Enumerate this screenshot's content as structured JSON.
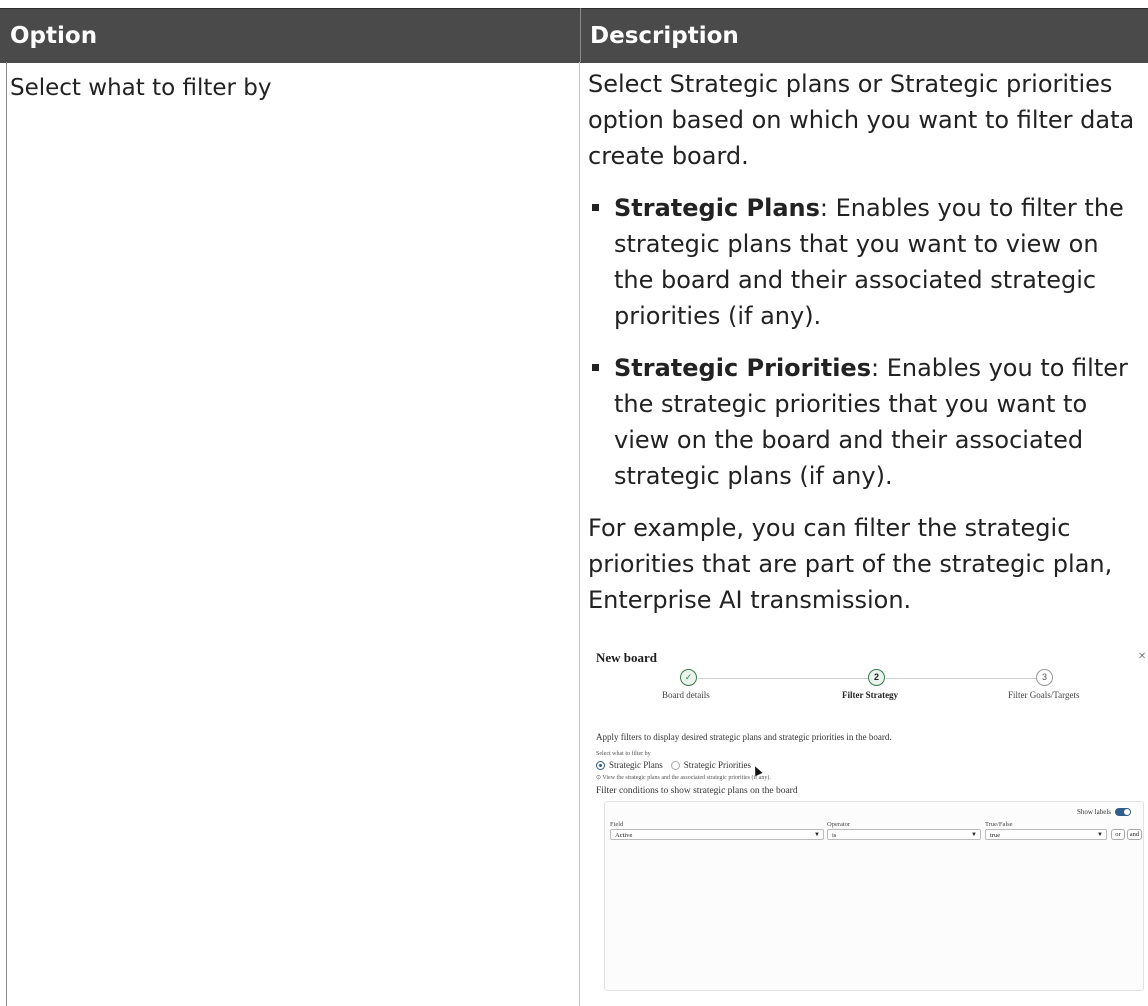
{
  "table": {
    "headers": [
      "Option",
      "Description"
    ],
    "option": "Select what to filter by",
    "description": {
      "intro": "Select Strategic plans or Strategic priorities option based on which you want to filter data create board.",
      "bullets": [
        {
          "term": "Strategic Plans",
          "text": ": Enables you to filter the strategic plans that you want to view on the board and their associated strategic priorities (if any)."
        },
        {
          "term": "Strategic Priorities",
          "text": ": Enables you to filter the strategic priorities that you want to view on the board and their associated strategic plans (if any)."
        }
      ],
      "example": "For example, you can filter the strategic priorities that are part of the strategic plan, Enterprise AI transmission."
    }
  },
  "screenshot": {
    "title": "New board",
    "close": "×",
    "steps": [
      {
        "icon": "✓",
        "label": "Board details"
      },
      {
        "icon": "2",
        "label": "Filter Strategy"
      },
      {
        "icon": "3",
        "label": "Filter Goals/Targets"
      }
    ],
    "apply_text": "Apply filters to display desired strategic plans and strategic priorities in the board.",
    "select_label": "Select what to filter by",
    "radio_plans": "Strategic Plans",
    "radio_priorities": "Strategic Priorities",
    "hint": "View the strategic plans and the associated strategic priorities (if any).",
    "conditions_title": "Filter conditions to show strategic plans on the board",
    "show_labels": "Show labels",
    "field_label": "Field",
    "field_value": "Active",
    "operator_label": "Operator",
    "operator_value": "is",
    "value_label": "True/False",
    "value_value": "true",
    "or_label": "or",
    "and_label": "and"
  }
}
